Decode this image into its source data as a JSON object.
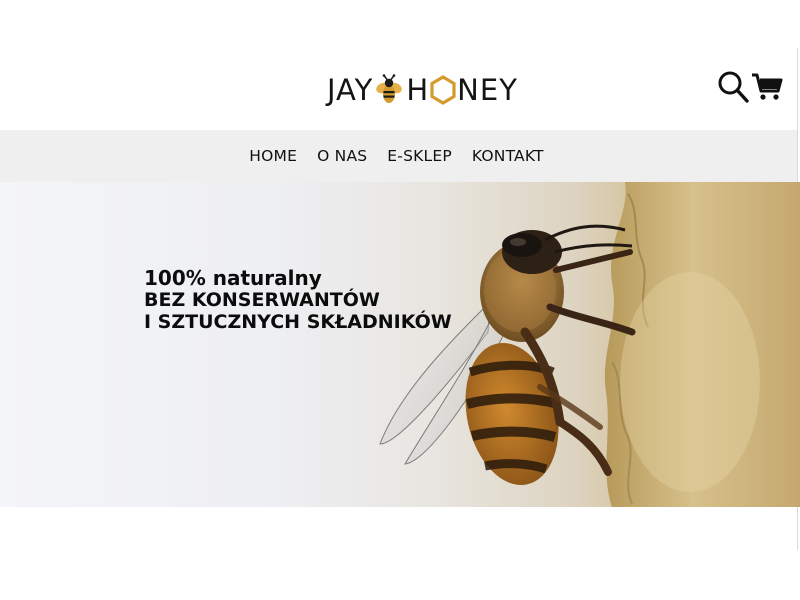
{
  "brand": {
    "logo_left": "JAY",
    "logo_right_first": "H",
    "logo_right_rest": "NEY",
    "accent_color": "#d39a2c",
    "text_color": "#141414"
  },
  "header": {
    "icons": [
      "search-icon",
      "cart-icon"
    ]
  },
  "nav": {
    "items": [
      {
        "label": "HOME"
      },
      {
        "label": "O NAS"
      },
      {
        "label": "E-SKLEP"
      },
      {
        "label": "KONTAKT"
      }
    ],
    "background": "#efefef"
  },
  "hero": {
    "line1": "100% naturalny",
    "line2": "BEZ KONSERWANTÓW",
    "line3": "I SZTUCZNYCH SKŁADNIKÓW",
    "image": "honey-bee-on-honeycomb"
  }
}
